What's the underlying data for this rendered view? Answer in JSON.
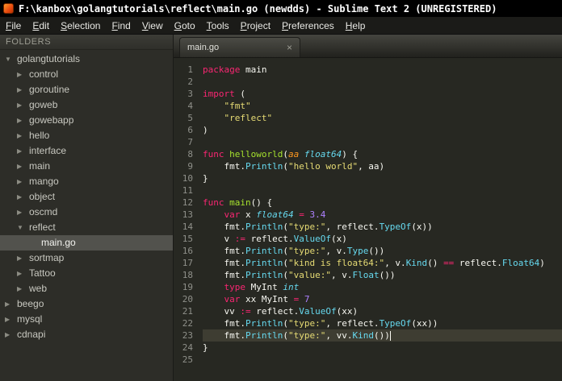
{
  "colors": {
    "titlebar-bg": "#000000",
    "titlebar-fg": "#ffffff",
    "menubar-bg": "#1b1b18",
    "menubar-fg": "#e8e8e4",
    "sidebar-bg": "#2d2d28",
    "sidebar-fg": "#c8c8c0",
    "folders-header-fg": "#9d9d93",
    "selected-bg": "#52524d",
    "editor-bg": "#272822",
    "currentline-bg": "#3e3d32",
    "gutter-fg": "#8f908a",
    "tab-fg": "#e0e0da",
    "c-fg": "#f8f8f2",
    "c-keyword": "#f92672",
    "c-string": "#e6db74",
    "c-number": "#ae81ff",
    "c-type": "#66d9ef",
    "c-func": "#66d9ef",
    "c-fname": "#a6e22e",
    "c-param": "#fd971f",
    "sublime-icon-color": "#e8490f"
  },
  "window": {
    "title": "F:\\kanbox\\golangtutorials\\reflect\\main.go (newdds) - Sublime Text 2 (UNREGISTERED)"
  },
  "menu": {
    "items": [
      "File",
      "Edit",
      "Selection",
      "Find",
      "View",
      "Goto",
      "Tools",
      "Project",
      "Preferences",
      "Help"
    ]
  },
  "sidebar": {
    "header": "FOLDERS",
    "items": [
      {
        "label": "golangtutorials",
        "level": 0,
        "state": "expanded"
      },
      {
        "label": "control",
        "level": 1,
        "state": "collapsed"
      },
      {
        "label": "goroutine",
        "level": 1,
        "state": "collapsed"
      },
      {
        "label": "goweb",
        "level": 1,
        "state": "collapsed"
      },
      {
        "label": "gowebapp",
        "level": 1,
        "state": "collapsed"
      },
      {
        "label": "hello",
        "level": 1,
        "state": "collapsed"
      },
      {
        "label": "interface",
        "level": 1,
        "state": "collapsed"
      },
      {
        "label": "main",
        "level": 1,
        "state": "collapsed"
      },
      {
        "label": "mango",
        "level": 1,
        "state": "collapsed"
      },
      {
        "label": "object",
        "level": 1,
        "state": "collapsed"
      },
      {
        "label": "oscmd",
        "level": 1,
        "state": "collapsed"
      },
      {
        "label": "reflect",
        "level": 1,
        "state": "expanded"
      },
      {
        "label": "main.go",
        "level": 2,
        "state": "file",
        "selected": true
      },
      {
        "label": "sortmap",
        "level": 1,
        "state": "collapsed"
      },
      {
        "label": "Tattoo",
        "level": 1,
        "state": "collapsed"
      },
      {
        "label": "web",
        "level": 1,
        "state": "collapsed"
      },
      {
        "label": "beego",
        "level": 0,
        "state": "collapsed"
      },
      {
        "label": "mysql",
        "level": 0,
        "state": "collapsed"
      },
      {
        "label": "cdnapi",
        "level": 0,
        "state": "collapsed"
      }
    ]
  },
  "tab": {
    "label": "main.go",
    "close": "×"
  },
  "editor": {
    "current_line": 23,
    "lines": [
      {
        "tokens": [
          [
            "k",
            "package"
          ],
          [
            "p",
            " main"
          ]
        ]
      },
      {
        "tokens": []
      },
      {
        "tokens": [
          [
            "k",
            "import"
          ],
          [
            "p",
            " ("
          ]
        ]
      },
      {
        "tokens": [
          [
            "p",
            "    "
          ],
          [
            "s",
            "\"fmt\""
          ]
        ]
      },
      {
        "tokens": [
          [
            "p",
            "    "
          ],
          [
            "s",
            "\"reflect\""
          ]
        ]
      },
      {
        "tokens": [
          [
            "p",
            ")"
          ]
        ]
      },
      {
        "tokens": []
      },
      {
        "tokens": [
          [
            "k",
            "func "
          ],
          [
            "g",
            "helloworld"
          ],
          [
            "p",
            "("
          ],
          [
            "a",
            "aa"
          ],
          [
            "p",
            " "
          ],
          [
            "t",
            "float64"
          ],
          [
            "p",
            ") {"
          ]
        ]
      },
      {
        "tokens": [
          [
            "p",
            "    fmt."
          ],
          [
            "f",
            "Println"
          ],
          [
            "p",
            "("
          ],
          [
            "s",
            "\"hello world\""
          ],
          [
            "p",
            ", aa)"
          ]
        ]
      },
      {
        "tokens": [
          [
            "p",
            "}"
          ]
        ]
      },
      {
        "tokens": []
      },
      {
        "tokens": [
          [
            "k",
            "func "
          ],
          [
            "g",
            "main"
          ],
          [
            "p",
            "() {"
          ]
        ]
      },
      {
        "tokens": [
          [
            "p",
            "    "
          ],
          [
            "k",
            "var"
          ],
          [
            "p",
            " x "
          ],
          [
            "t",
            "float64"
          ],
          [
            "p",
            " "
          ],
          [
            "o",
            "="
          ],
          [
            "p",
            " "
          ],
          [
            "n",
            "3.4"
          ]
        ]
      },
      {
        "tokens": [
          [
            "p",
            "    fmt."
          ],
          [
            "f",
            "Println"
          ],
          [
            "p",
            "("
          ],
          [
            "s",
            "\"type:\""
          ],
          [
            "p",
            ", reflect."
          ],
          [
            "f",
            "TypeOf"
          ],
          [
            "p",
            "(x))"
          ]
        ]
      },
      {
        "tokens": [
          [
            "p",
            "    v "
          ],
          [
            "o",
            ":="
          ],
          [
            "p",
            " reflect."
          ],
          [
            "f",
            "ValueOf"
          ],
          [
            "p",
            "(x)"
          ]
        ]
      },
      {
        "tokens": [
          [
            "p",
            "    fmt."
          ],
          [
            "f",
            "Println"
          ],
          [
            "p",
            "("
          ],
          [
            "s",
            "\"type:\""
          ],
          [
            "p",
            ", v."
          ],
          [
            "f",
            "Type"
          ],
          [
            "p",
            "())"
          ]
        ]
      },
      {
        "tokens": [
          [
            "p",
            "    fmt."
          ],
          [
            "f",
            "Println"
          ],
          [
            "p",
            "("
          ],
          [
            "s",
            "\"kind is float64:\""
          ],
          [
            "p",
            ", v."
          ],
          [
            "f",
            "Kind"
          ],
          [
            "p",
            "() "
          ],
          [
            "o",
            "=="
          ],
          [
            "p",
            " reflect."
          ],
          [
            "f",
            "Float64"
          ],
          [
            "p",
            ")"
          ]
        ]
      },
      {
        "tokens": [
          [
            "p",
            "    fmt."
          ],
          [
            "f",
            "Println"
          ],
          [
            "p",
            "("
          ],
          [
            "s",
            "\"value:\""
          ],
          [
            "p",
            ", v."
          ],
          [
            "f",
            "Float"
          ],
          [
            "p",
            "())"
          ]
        ]
      },
      {
        "tokens": [
          [
            "p",
            "    "
          ],
          [
            "k",
            "type"
          ],
          [
            "p",
            " MyInt "
          ],
          [
            "t",
            "int"
          ]
        ]
      },
      {
        "tokens": [
          [
            "p",
            "    "
          ],
          [
            "k",
            "var"
          ],
          [
            "p",
            " xx MyInt "
          ],
          [
            "o",
            "="
          ],
          [
            "p",
            " "
          ],
          [
            "n",
            "7"
          ]
        ]
      },
      {
        "tokens": [
          [
            "p",
            "    vv "
          ],
          [
            "o",
            ":="
          ],
          [
            "p",
            " reflect."
          ],
          [
            "f",
            "ValueOf"
          ],
          [
            "p",
            "(xx)"
          ]
        ]
      },
      {
        "tokens": [
          [
            "p",
            "    fmt."
          ],
          [
            "f",
            "Println"
          ],
          [
            "p",
            "("
          ],
          [
            "s",
            "\"type:\""
          ],
          [
            "p",
            ", reflect."
          ],
          [
            "f",
            "TypeOf"
          ],
          [
            "p",
            "(xx))"
          ]
        ]
      },
      {
        "tokens": [
          [
            "p",
            "    fmt."
          ],
          [
            "f",
            "Println"
          ],
          [
            "p",
            "("
          ],
          [
            "s",
            "\"type:\""
          ],
          [
            "p",
            ", vv."
          ],
          [
            "f",
            "Kind"
          ],
          [
            "p",
            "())"
          ]
        ],
        "cursor": true
      },
      {
        "tokens": [
          [
            "p",
            "}"
          ]
        ]
      },
      {
        "tokens": []
      }
    ]
  }
}
